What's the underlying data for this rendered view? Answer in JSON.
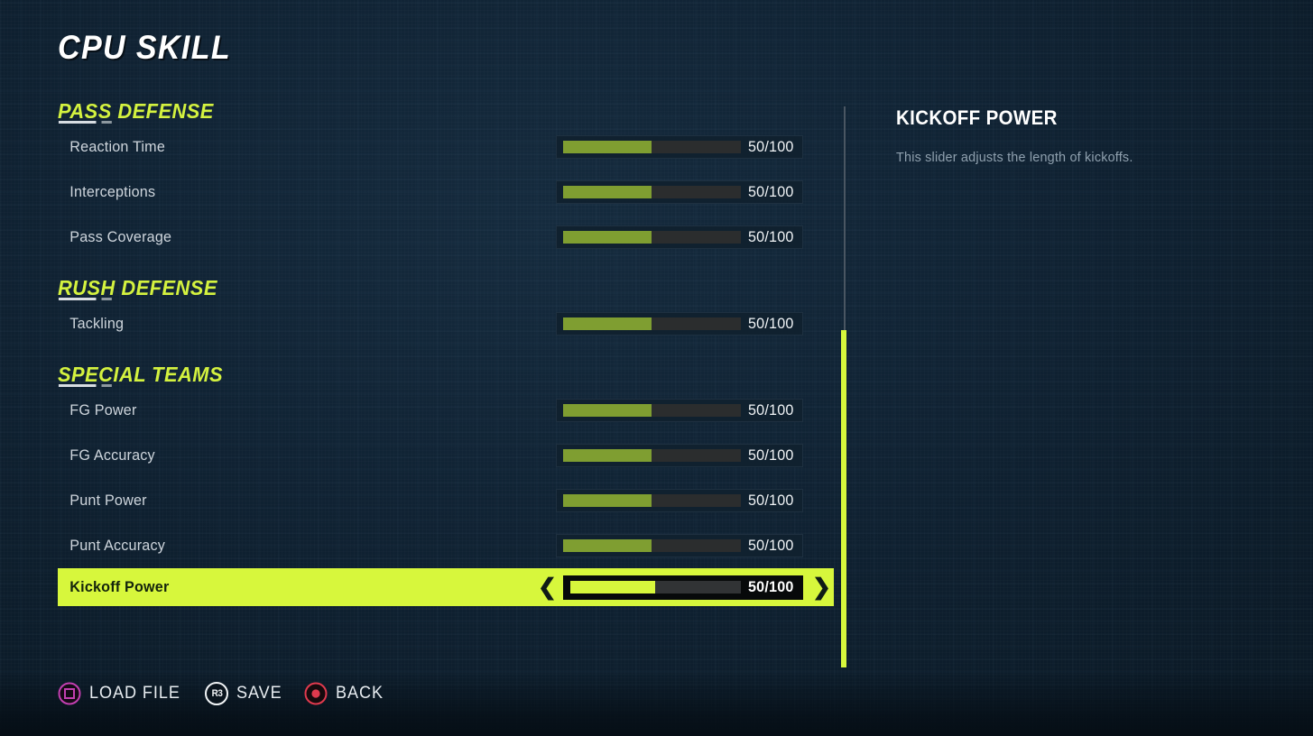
{
  "header": {
    "title": "CPU SKILL"
  },
  "theme": {
    "background": "#102334",
    "accent": "#d7f73c",
    "section_heading": "#d4f23f",
    "slider_fill": "#7f9e31",
    "label": "#ced5dc",
    "square_button": "#c23fb0",
    "circle_button": "#e03a4e"
  },
  "sections": [
    {
      "heading": "PASS DEFENSE",
      "clipped": true,
      "rows": [
        {
          "label": "Reaction Time",
          "value": "50/100",
          "percent": 50,
          "selected": false
        },
        {
          "label": "Interceptions",
          "value": "50/100",
          "percent": 50,
          "selected": false
        },
        {
          "label": "Pass Coverage",
          "value": "50/100",
          "percent": 50,
          "selected": false
        }
      ]
    },
    {
      "heading": "RUSH DEFENSE",
      "clipped": false,
      "rows": [
        {
          "label": "Tackling",
          "value": "50/100",
          "percent": 50,
          "selected": false
        }
      ]
    },
    {
      "heading": "SPECIAL TEAMS",
      "clipped": false,
      "rows": [
        {
          "label": "FG Power",
          "value": "50/100",
          "percent": 50,
          "selected": false
        },
        {
          "label": "FG Accuracy",
          "value": "50/100",
          "percent": 50,
          "selected": false
        },
        {
          "label": "Punt Power",
          "value": "50/100",
          "percent": 50,
          "selected": false
        },
        {
          "label": "Punt Accuracy",
          "value": "50/100",
          "percent": 50,
          "selected": false
        },
        {
          "label": "Kickoff Power",
          "value": "50/100",
          "percent": 50,
          "selected": true
        }
      ]
    }
  ],
  "selected_arrows": {
    "left": "❮",
    "right": "❯"
  },
  "info_panel": {
    "title": "KICKOFF POWER",
    "description": "This slider adjusts the length of kickoffs."
  },
  "scrollbar": {
    "thumb_top_pct": 40,
    "thumb_height_pct": 60
  },
  "action_bar": [
    {
      "icon": "square-button-icon",
      "label": "LOAD FILE"
    },
    {
      "icon": "r3-button-icon",
      "label": "SAVE",
      "glyph": "R3"
    },
    {
      "icon": "circle-button-icon",
      "label": "BACK"
    }
  ]
}
